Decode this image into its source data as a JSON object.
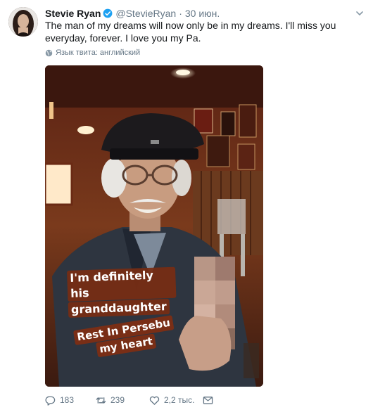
{
  "tweet": {
    "author_name": "Stevie Ryan",
    "handle": "@StevieRyan",
    "separator": "·",
    "date": "30 июн.",
    "text": "The man of my dreams will now only be in my dreams. I'll miss you everyday, forever. I love you my Pa.",
    "language_note": "Язык твита: английский",
    "media": {
      "sticker_1_line_1": "I'm definitely his",
      "sticker_1_line_2": "granddaughter",
      "sticker_2_line_1": "Rest In Persebu",
      "sticker_2_line_2": "my heart"
    },
    "actions": {
      "reply_count": "183",
      "retweet_count": "239",
      "like_count": "2,2 тыс."
    }
  },
  "colors": {
    "text": "#14171a",
    "secondary": "#657786",
    "verified": "#1da1f2",
    "sticker_bg": "#782c12"
  },
  "icons": [
    "avatar",
    "verified-badge-icon",
    "chevron-down-icon",
    "globe-icon",
    "reply-icon",
    "retweet-icon",
    "like-icon",
    "direct-message-icon"
  ]
}
